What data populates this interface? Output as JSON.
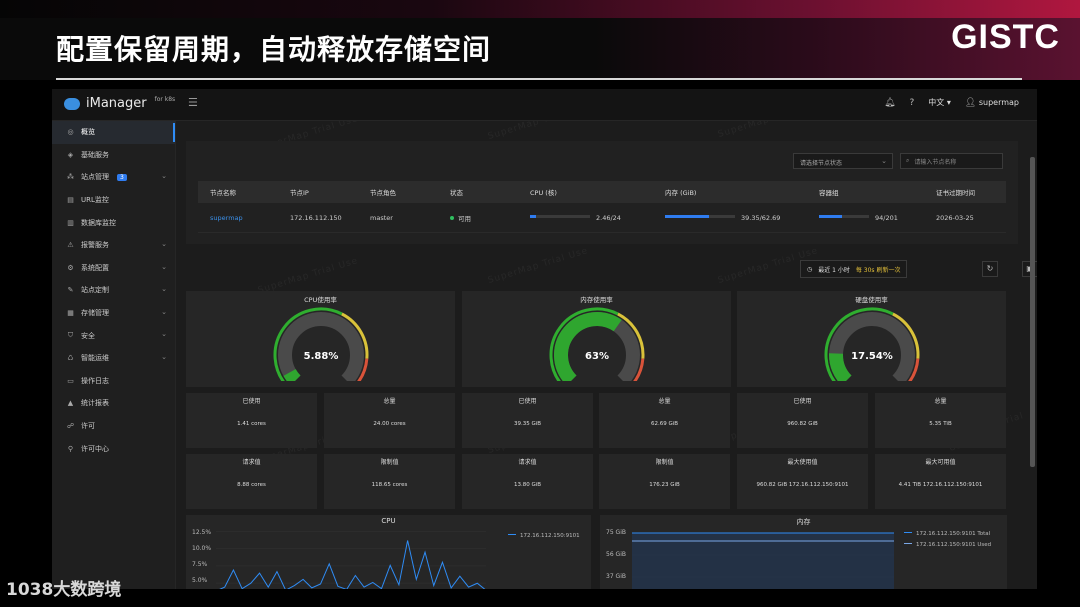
{
  "slide": {
    "title": "配置保留周期，自动释放存储空间",
    "brand": "GISTC",
    "corner_logo": "1038大数跨境"
  },
  "app": {
    "name": "iManager",
    "name_suffix": "for k8s",
    "topbar": {
      "language": "中文",
      "user": "supermap"
    }
  },
  "sidebar": {
    "items": [
      {
        "label": "概览",
        "icon": "dashboard-icon",
        "active": true
      },
      {
        "label": "基础服务",
        "icon": "layers-icon"
      },
      {
        "label": "站点管理",
        "icon": "sites-icon",
        "badge": "3",
        "chev": true
      },
      {
        "label": "URL监控",
        "icon": "url-icon"
      },
      {
        "label": "数据库监控",
        "icon": "database-icon"
      },
      {
        "label": "报警服务",
        "icon": "alarm-icon",
        "chev": true
      },
      {
        "label": "系统配置",
        "icon": "settings-icon",
        "chev": true
      },
      {
        "label": "站点定制",
        "icon": "wrench-icon",
        "chev": true
      },
      {
        "label": "存储管理",
        "icon": "storage-icon",
        "chev": true
      },
      {
        "label": "安全",
        "icon": "shield-icon",
        "chev": true
      },
      {
        "label": "智能运维",
        "icon": "ops-icon",
        "chev": true
      },
      {
        "label": "操作日志",
        "icon": "log-icon"
      },
      {
        "label": "统计报表",
        "icon": "chart-icon"
      },
      {
        "label": "许可",
        "icon": "license-icon"
      },
      {
        "label": "许可中心",
        "icon": "license-center-icon"
      }
    ]
  },
  "nodes": {
    "status_select": "请选择节点状态",
    "search_placeholder": "请输入节点名称",
    "columns": [
      "节点名称",
      "节点IP",
      "节点角色",
      "状态",
      "CPU (核)",
      "内存 (GiB)",
      "容器组",
      "证书过期时间"
    ],
    "rows": [
      {
        "name": "supermap",
        "ip": "172.16.112.150",
        "role": "master",
        "status": "可用",
        "cpu": "2.46/24",
        "cpu_frac": 0.1025,
        "mem": "39.35/62.69",
        "mem_frac": 0.6277,
        "pods": "94/201",
        "pods_frac": 0.4677,
        "cert_expiry": "2026-03-25"
      }
    ]
  },
  "monitor": {
    "range": "最近 1 小时",
    "refresh": "每 30s 刷新一次",
    "watermark": "SuperMap Trial Use"
  },
  "gauges": [
    {
      "title": "CPU使用率",
      "value": 5.88,
      "label": "5.88%"
    },
    {
      "title": "内存使用率",
      "value": 63,
      "label": "63%"
    },
    {
      "title": "硬盘使用率",
      "value": 17.54,
      "label": "17.54%"
    }
  ],
  "stats": {
    "row1": [
      {
        "label": "已使用",
        "value": "1.41 cores"
      },
      {
        "label": "总量",
        "value": "24.00 cores"
      },
      {
        "label": "已使用",
        "value": "39.35 GiB"
      },
      {
        "label": "总量",
        "value": "62.69 GiB"
      },
      {
        "label": "已使用",
        "value": "960.82 GiB"
      },
      {
        "label": "总量",
        "value": "5.35 TiB"
      }
    ],
    "row2": [
      {
        "label": "请求值",
        "value": "8.88 cores"
      },
      {
        "label": "限制值",
        "value": "118.65 cores"
      },
      {
        "label": "请求值",
        "value": "13.80 GiB"
      },
      {
        "label": "限制值",
        "value": "176.23 GiB"
      },
      {
        "label": "最大使用值",
        "value": "960.82 GiB 172.16.112.150:9101"
      },
      {
        "label": "最大可用值",
        "value": "4.41 TiB 172.16.112.150:9101"
      }
    ]
  },
  "charts": {
    "cpu": {
      "title": "CPU",
      "yticks": [
        "12.5%",
        "10.0%",
        "7.5%",
        "5.0%"
      ],
      "legend": [
        "172.16.112.150:9101"
      ]
    },
    "mem": {
      "title": "内存",
      "yticks": [
        "75 GiB",
        "56 GiB",
        "37 GiB"
      ],
      "legend": [
        "172.16.112.150:9101 Total",
        "172.16.112.150:9101 Used"
      ]
    }
  },
  "chart_data": {
    "type": "line",
    "title": "CPU",
    "series": [
      {
        "name": "172.16.112.150:9101",
        "values": [
          4.5,
          5.0,
          7.2,
          4.8,
          5.5,
          6.8,
          5.0,
          7.0,
          4.6,
          5.2,
          6.0,
          4.9,
          5.4,
          8.0,
          5.1,
          4.7,
          6.5,
          5.0,
          5.6,
          4.8,
          7.8,
          5.3,
          11.0,
          6.0,
          9.5,
          5.2,
          8.2,
          4.9,
          6.4,
          5.0,
          5.5,
          4.6
        ]
      }
    ],
    "ylim": [
      4.5,
      13
    ]
  }
}
